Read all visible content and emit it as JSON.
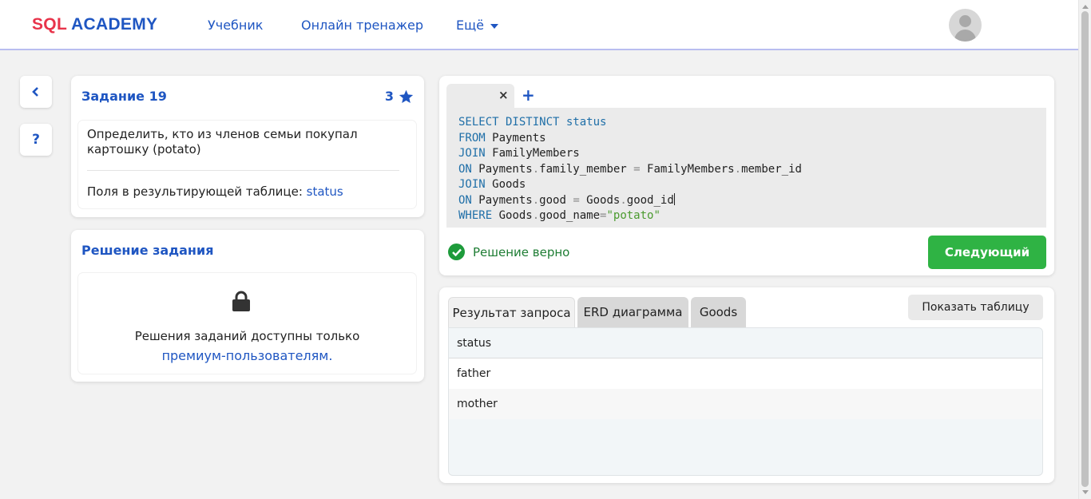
{
  "header": {
    "logo_sql": "SQL",
    "logo_academy": "ACADEMY",
    "nav": [
      "Учебник",
      "Онлайн тренажер",
      "Ещё"
    ]
  },
  "sidebar": {
    "back_label": "‹",
    "help_label": "?"
  },
  "task": {
    "title": "Задание 19",
    "score": "3",
    "description": "Определить, кто из членов семьи покупал картошку (potato)",
    "fields_label": "Поля в результирующей таблице:",
    "fields_value": "status"
  },
  "solution": {
    "title": "Решение задания",
    "locked_text": "Решения заданий доступны только",
    "premium_link": "премиум-пользователям."
  },
  "editor": {
    "tab_close": "×",
    "tab_add": "+",
    "code_lines": [
      [
        {
          "t": "SELECT DISTINCT status",
          "c": "kw"
        }
      ],
      [
        {
          "t": "FROM",
          "c": "kw"
        },
        {
          "t": " Payments",
          "c": ""
        }
      ],
      [
        {
          "t": "JOIN",
          "c": "kw"
        },
        {
          "t": " FamilyMembers",
          "c": ""
        }
      ],
      [
        {
          "t": "ON",
          "c": "kw"
        },
        {
          "t": " Payments",
          "c": ""
        },
        {
          "t": ".",
          "c": "op"
        },
        {
          "t": "family_member ",
          "c": ""
        },
        {
          "t": "=",
          "c": "op"
        },
        {
          "t": " FamilyMembers",
          "c": ""
        },
        {
          "t": ".",
          "c": "op"
        },
        {
          "t": "member_id",
          "c": ""
        }
      ],
      [
        {
          "t": "JOIN",
          "c": "kw"
        },
        {
          "t": " Goods",
          "c": ""
        }
      ],
      [
        {
          "t": "ON",
          "c": "kw"
        },
        {
          "t": " Payments",
          "c": ""
        },
        {
          "t": ".",
          "c": "op"
        },
        {
          "t": "good ",
          "c": ""
        },
        {
          "t": "=",
          "c": "op"
        },
        {
          "t": " Goods",
          "c": ""
        },
        {
          "t": ".",
          "c": "op"
        },
        {
          "t": "good_id",
          "c": ""
        },
        {
          "t": "",
          "c": "cursor"
        }
      ],
      [
        {
          "t": "WHERE",
          "c": "kw"
        },
        {
          "t": " Goods",
          "c": ""
        },
        {
          "t": ".",
          "c": "op"
        },
        {
          "t": "good_name",
          "c": ""
        },
        {
          "t": "=",
          "c": "op"
        },
        {
          "t": "\"potato\"",
          "c": "str"
        }
      ]
    ],
    "status_text": "Решение верно",
    "next_button": "Следующий"
  },
  "result": {
    "tabs": [
      "Результат запроса",
      "ERD диаграмма",
      "Goods"
    ],
    "show_table_button": "Показать таблицу",
    "columns": [
      "status"
    ],
    "rows": [
      [
        "father"
      ],
      [
        "mother"
      ]
    ]
  },
  "colors": {
    "brand_blue": "#1f56c2",
    "logo_red": "#e8334a",
    "success_green": "#2fb344"
  }
}
